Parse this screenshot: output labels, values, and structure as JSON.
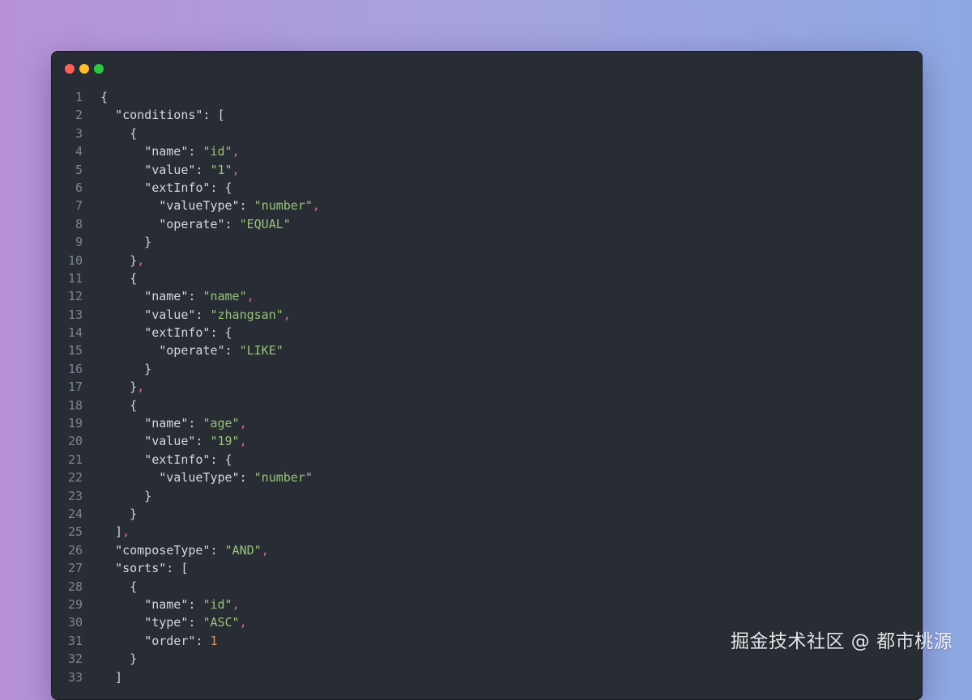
{
  "window": {
    "controls": [
      {
        "name": "close-button",
        "color": "#ff5f57"
      },
      {
        "name": "minimize-button",
        "color": "#febc2e"
      },
      {
        "name": "zoom-button",
        "color": "#28c840"
      }
    ]
  },
  "code": {
    "lines": [
      {
        "n": "1",
        "tokens": [
          {
            "t": "p",
            "v": "{"
          }
        ]
      },
      {
        "n": "2",
        "tokens": [
          {
            "t": "p",
            "v": "  "
          },
          {
            "t": "k",
            "v": "\"conditions\""
          },
          {
            "t": "p",
            "v": ": ["
          }
        ]
      },
      {
        "n": "3",
        "tokens": [
          {
            "t": "p",
            "v": "    {"
          }
        ]
      },
      {
        "n": "4",
        "tokens": [
          {
            "t": "p",
            "v": "      "
          },
          {
            "t": "k",
            "v": "\"name\""
          },
          {
            "t": "p",
            "v": ": "
          },
          {
            "t": "s",
            "v": "\"id\""
          },
          {
            "t": "c",
            "v": ","
          }
        ]
      },
      {
        "n": "5",
        "tokens": [
          {
            "t": "p",
            "v": "      "
          },
          {
            "t": "k",
            "v": "\"value\""
          },
          {
            "t": "p",
            "v": ": "
          },
          {
            "t": "s",
            "v": "\"1\""
          },
          {
            "t": "c",
            "v": ","
          }
        ]
      },
      {
        "n": "6",
        "tokens": [
          {
            "t": "p",
            "v": "      "
          },
          {
            "t": "k",
            "v": "\"extInfo\""
          },
          {
            "t": "p",
            "v": ": {"
          }
        ]
      },
      {
        "n": "7",
        "tokens": [
          {
            "t": "p",
            "v": "        "
          },
          {
            "t": "k",
            "v": "\"valueType\""
          },
          {
            "t": "p",
            "v": ": "
          },
          {
            "t": "s",
            "v": "\"number\""
          },
          {
            "t": "c",
            "v": ","
          }
        ]
      },
      {
        "n": "8",
        "tokens": [
          {
            "t": "p",
            "v": "        "
          },
          {
            "t": "k",
            "v": "\"operate\""
          },
          {
            "t": "p",
            "v": ": "
          },
          {
            "t": "s",
            "v": "\"EQUAL\""
          }
        ]
      },
      {
        "n": "9",
        "tokens": [
          {
            "t": "p",
            "v": "      }"
          }
        ]
      },
      {
        "n": "10",
        "tokens": [
          {
            "t": "p",
            "v": "    }"
          },
          {
            "t": "c",
            "v": ","
          }
        ]
      },
      {
        "n": "11",
        "tokens": [
          {
            "t": "p",
            "v": "    {"
          }
        ]
      },
      {
        "n": "12",
        "tokens": [
          {
            "t": "p",
            "v": "      "
          },
          {
            "t": "k",
            "v": "\"name\""
          },
          {
            "t": "p",
            "v": ": "
          },
          {
            "t": "s",
            "v": "\"name\""
          },
          {
            "t": "c",
            "v": ","
          }
        ]
      },
      {
        "n": "13",
        "tokens": [
          {
            "t": "p",
            "v": "      "
          },
          {
            "t": "k",
            "v": "\"value\""
          },
          {
            "t": "p",
            "v": ": "
          },
          {
            "t": "s",
            "v": "\"zhangsan\""
          },
          {
            "t": "c",
            "v": ","
          }
        ]
      },
      {
        "n": "14",
        "tokens": [
          {
            "t": "p",
            "v": "      "
          },
          {
            "t": "k",
            "v": "\"extInfo\""
          },
          {
            "t": "p",
            "v": ": {"
          }
        ]
      },
      {
        "n": "15",
        "tokens": [
          {
            "t": "p",
            "v": "        "
          },
          {
            "t": "k",
            "v": "\"operate\""
          },
          {
            "t": "p",
            "v": ": "
          },
          {
            "t": "s",
            "v": "\"LIKE\""
          }
        ]
      },
      {
        "n": "16",
        "tokens": [
          {
            "t": "p",
            "v": "      }"
          }
        ]
      },
      {
        "n": "17",
        "tokens": [
          {
            "t": "p",
            "v": "    }"
          },
          {
            "t": "c",
            "v": ","
          }
        ]
      },
      {
        "n": "18",
        "tokens": [
          {
            "t": "p",
            "v": "    {"
          }
        ]
      },
      {
        "n": "19",
        "tokens": [
          {
            "t": "p",
            "v": "      "
          },
          {
            "t": "k",
            "v": "\"name\""
          },
          {
            "t": "p",
            "v": ": "
          },
          {
            "t": "s",
            "v": "\"age\""
          },
          {
            "t": "c",
            "v": ","
          }
        ]
      },
      {
        "n": "20",
        "tokens": [
          {
            "t": "p",
            "v": "      "
          },
          {
            "t": "k",
            "v": "\"value\""
          },
          {
            "t": "p",
            "v": ": "
          },
          {
            "t": "s",
            "v": "\"19\""
          },
          {
            "t": "c",
            "v": ","
          }
        ]
      },
      {
        "n": "21",
        "tokens": [
          {
            "t": "p",
            "v": "      "
          },
          {
            "t": "k",
            "v": "\"extInfo\""
          },
          {
            "t": "p",
            "v": ": {"
          }
        ]
      },
      {
        "n": "22",
        "tokens": [
          {
            "t": "p",
            "v": "        "
          },
          {
            "t": "k",
            "v": "\"valueType\""
          },
          {
            "t": "p",
            "v": ": "
          },
          {
            "t": "s",
            "v": "\"number\""
          }
        ]
      },
      {
        "n": "23",
        "tokens": [
          {
            "t": "p",
            "v": "      }"
          }
        ]
      },
      {
        "n": "24",
        "tokens": [
          {
            "t": "p",
            "v": "    }"
          }
        ]
      },
      {
        "n": "25",
        "tokens": [
          {
            "t": "p",
            "v": "  ]"
          },
          {
            "t": "c",
            "v": ","
          }
        ]
      },
      {
        "n": "26",
        "tokens": [
          {
            "t": "p",
            "v": "  "
          },
          {
            "t": "k",
            "v": "\"composeType\""
          },
          {
            "t": "p",
            "v": ": "
          },
          {
            "t": "s",
            "v": "\"AND\""
          },
          {
            "t": "c",
            "v": ","
          }
        ]
      },
      {
        "n": "27",
        "tokens": [
          {
            "t": "p",
            "v": "  "
          },
          {
            "t": "k",
            "v": "\"sorts\""
          },
          {
            "t": "p",
            "v": ": ["
          }
        ]
      },
      {
        "n": "28",
        "tokens": [
          {
            "t": "p",
            "v": "    {"
          }
        ]
      },
      {
        "n": "29",
        "tokens": [
          {
            "t": "p",
            "v": "      "
          },
          {
            "t": "k",
            "v": "\"name\""
          },
          {
            "t": "p",
            "v": ": "
          },
          {
            "t": "s",
            "v": "\"id\""
          },
          {
            "t": "c",
            "v": ","
          }
        ]
      },
      {
        "n": "30",
        "tokens": [
          {
            "t": "p",
            "v": "      "
          },
          {
            "t": "k",
            "v": "\"type\""
          },
          {
            "t": "p",
            "v": ": "
          },
          {
            "t": "s",
            "v": "\"ASC\""
          },
          {
            "t": "c",
            "v": ","
          }
        ]
      },
      {
        "n": "31",
        "tokens": [
          {
            "t": "p",
            "v": "      "
          },
          {
            "t": "k",
            "v": "\"order\""
          },
          {
            "t": "p",
            "v": ": "
          },
          {
            "t": "num",
            "v": "1"
          }
        ]
      },
      {
        "n": "32",
        "tokens": [
          {
            "t": "p",
            "v": "    }"
          }
        ]
      },
      {
        "n": "33",
        "tokens": [
          {
            "t": "p",
            "v": "  ]"
          }
        ]
      }
    ]
  },
  "watermark": {
    "text": "掘金技术社区 @ 都市桃源"
  }
}
